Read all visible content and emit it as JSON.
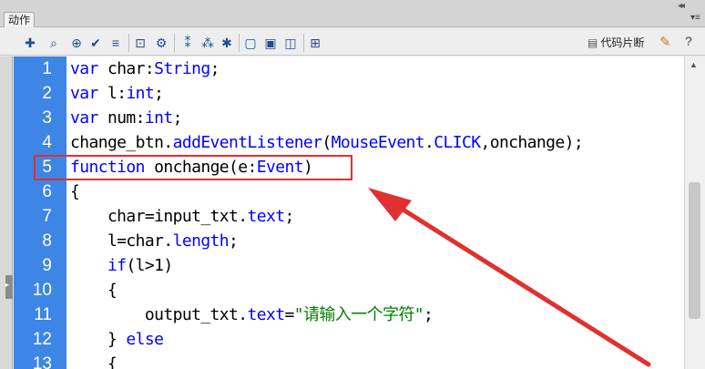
{
  "panel": {
    "tab_label": "动作",
    "collapse_glyph": "◂◂",
    "menu_glyph": "▾≡"
  },
  "toolbar": {
    "icons": [
      "add-statement-icon",
      "find-icon",
      "target-icon",
      "check-syntax-icon",
      "auto-format-icon",
      "code-hint-icon",
      "debug-options-icon",
      "collapse-between-braces-icon",
      "collapse-selection-icon",
      "expand-all-icon",
      "apply-block-comment-icon",
      "apply-line-comment-icon",
      "remove-comment-icon",
      "show-hide-toolbox-icon"
    ],
    "snippets_label": "代码片断",
    "wand_icon": "wand-icon",
    "help_icon": "help-icon"
  },
  "editor": {
    "line_numbers": [
      "1",
      "2",
      "3",
      "4",
      "5",
      "6",
      "7",
      "8",
      "9",
      "10",
      "11",
      "12",
      "13"
    ],
    "lines": [
      [
        {
          "t": "var",
          "c": "kw"
        },
        {
          "t": " char:",
          "c": ""
        },
        {
          "t": "String",
          "c": "ty"
        },
        {
          "t": ";",
          "c": ""
        }
      ],
      [
        {
          "t": "var",
          "c": "kw"
        },
        {
          "t": " l:",
          "c": ""
        },
        {
          "t": "int",
          "c": "ty"
        },
        {
          "t": ";",
          "c": ""
        }
      ],
      [
        {
          "t": "var",
          "c": "kw"
        },
        {
          "t": " num:",
          "c": ""
        },
        {
          "t": "int",
          "c": "ty"
        },
        {
          "t": ";",
          "c": ""
        }
      ],
      [
        {
          "t": "change_btn.",
          "c": ""
        },
        {
          "t": "addEventListener",
          "c": "pr"
        },
        {
          "t": "(",
          "c": ""
        },
        {
          "t": "MouseEvent",
          "c": "ty"
        },
        {
          "t": ".",
          "c": ""
        },
        {
          "t": "CLICK",
          "c": "cn"
        },
        {
          "t": ",onchange);",
          "c": ""
        }
      ],
      [
        {
          "t": "function",
          "c": "kw"
        },
        {
          "t": " onchange(e:",
          "c": ""
        },
        {
          "t": "Event",
          "c": "ty"
        },
        {
          "t": ")",
          "c": ""
        }
      ],
      [
        {
          "t": "{",
          "c": ""
        }
      ],
      [
        {
          "t": "    char=input_txt.",
          "c": ""
        },
        {
          "t": "text",
          "c": "pr"
        },
        {
          "t": ";",
          "c": ""
        }
      ],
      [
        {
          "t": "    l=char.",
          "c": ""
        },
        {
          "t": "length",
          "c": "pr"
        },
        {
          "t": ";",
          "c": ""
        }
      ],
      [
        {
          "t": "    ",
          "c": ""
        },
        {
          "t": "if",
          "c": "kw"
        },
        {
          "t": "(l>1)",
          "c": ""
        }
      ],
      [
        {
          "t": "    {",
          "c": ""
        }
      ],
      [
        {
          "t": "        output_txt.",
          "c": ""
        },
        {
          "t": "text",
          "c": "pr"
        },
        {
          "t": "=",
          "c": ""
        },
        {
          "t": "\"请输入一个字符\"",
          "c": "st"
        },
        {
          "t": ";",
          "c": ""
        }
      ],
      [
        {
          "t": "    } ",
          "c": ""
        },
        {
          "t": "else",
          "c": "kw"
        }
      ],
      [
        {
          "t": "    {",
          "c": ""
        }
      ]
    ]
  },
  "annotation": {
    "highlight_line": 5,
    "color": "#e03030"
  },
  "colors": {
    "gutter": "#3d86e5",
    "keyword": "#0000ff",
    "string": "#008000"
  }
}
